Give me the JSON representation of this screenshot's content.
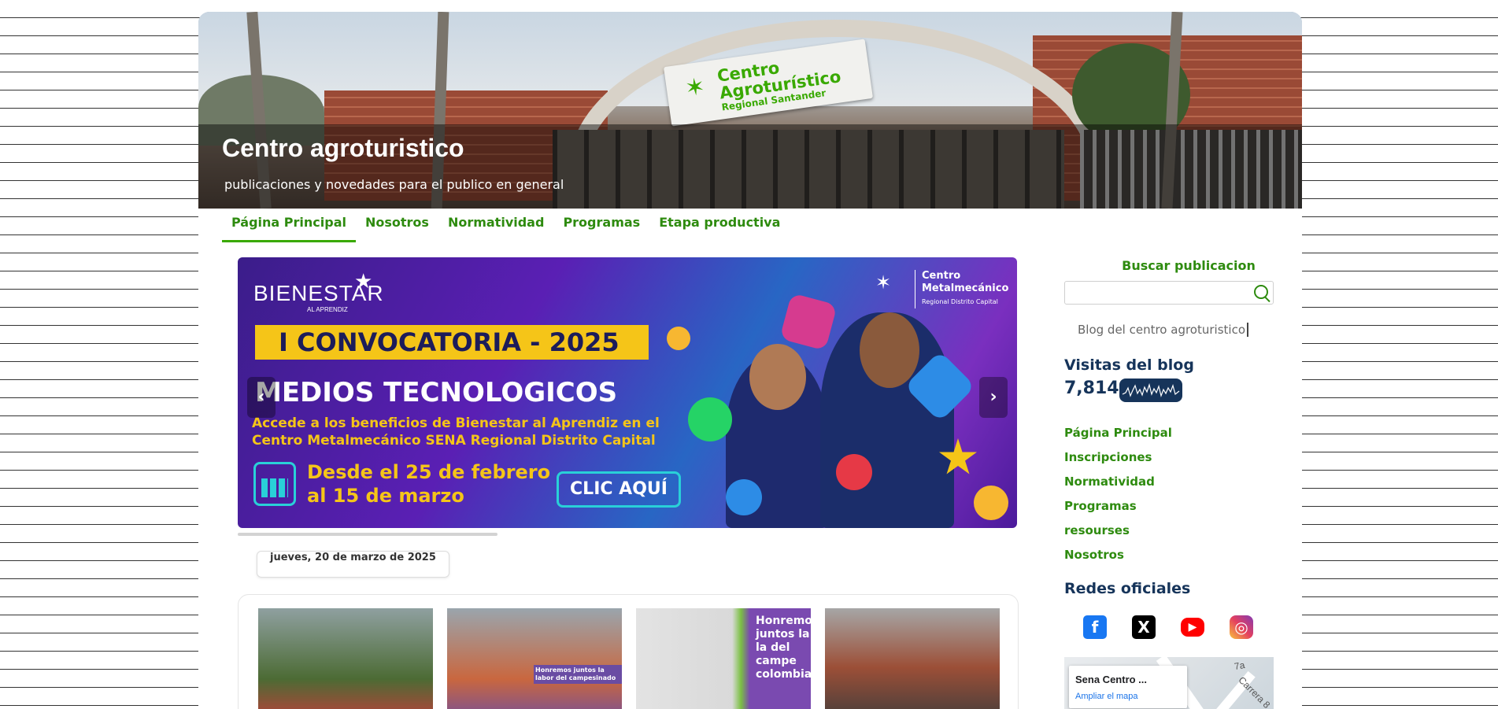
{
  "header": {
    "title": "Centro agroturistico",
    "description": "publicaciones y novedades para el publico en general",
    "sign": {
      "line1": "Centro",
      "line2": "Agroturístico",
      "line3": "Regional Santander",
      "logo": "SENA"
    }
  },
  "nav": {
    "items": [
      {
        "label": "Página Principal",
        "active": true
      },
      {
        "label": "Nosotros",
        "active": false
      },
      {
        "label": "Normatividad",
        "active": false
      },
      {
        "label": "Programas",
        "active": false
      },
      {
        "label": "Etapa productiva",
        "active": false
      }
    ]
  },
  "slider": {
    "brand": "BIENESTAR",
    "brand_sub": "AL APRENDIZ",
    "convocatoria": "I CONVOCATORIA - 2025",
    "headline": "MEDIOS TECNOLOGICOS",
    "body": "Accede a los beneficios de Bienestar al Aprendiz en el Centro Metalmecánico SENA Regional Distrito Capital",
    "dates_line1": "Desde el 25 de febrero",
    "dates_line2": "al 15 de marzo",
    "cta": "CLIC AQUÍ",
    "center_name": "Centro Metalmecánico",
    "center_region": "Regional Distrito Capital",
    "prev_icon": "chevron-left-icon",
    "next_icon": "chevron-right-icon"
  },
  "post": {
    "date": "jueves, 20 de marzo de 2025",
    "thumb3_caption": "Honremos juntos la la del campe colombian",
    "thumb2_caption": "Honremos juntos la labor del campesinado"
  },
  "sidebar": {
    "search_title": "Buscar publicacion",
    "search_placeholder": "",
    "search_icon": "search-icon",
    "blog_link": "Blog del centro agroturistico",
    "visits_title": "Visitas del blog",
    "visits_count": "7,814",
    "links": [
      "Página Principal",
      "Inscripciones",
      "Normatividad",
      "Programas",
      "resourses",
      "Nosotros"
    ],
    "social_title": "Redes oficiales",
    "social": [
      "facebook-icon",
      "x-icon",
      "youtube-icon",
      "instagram-icon"
    ],
    "map": {
      "place": "Sena Centro ...",
      "link": "Ampliar el mapa",
      "street1": "7a",
      "street2": "Carrera 8"
    }
  },
  "colors": {
    "accent_green": "#2e8b0f",
    "dark_blue": "#16345a",
    "banner_yellow": "#f5c518"
  }
}
